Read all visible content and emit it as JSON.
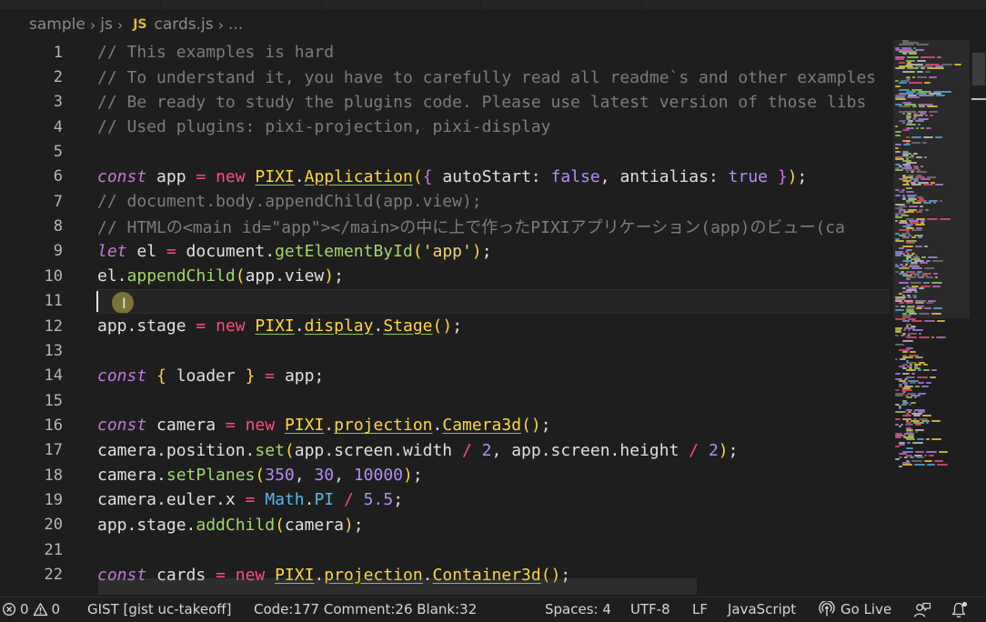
{
  "breadcrumb": {
    "folder1": "sample",
    "folder2": "js",
    "file_badge": "JS",
    "file": "cards.js",
    "more": "..."
  },
  "editor": {
    "line_numbers": [
      "1",
      "2",
      "3",
      "4",
      "5",
      "6",
      "7",
      "8",
      "9",
      "10",
      "11",
      "12",
      "13",
      "14",
      "15",
      "16",
      "17",
      "18",
      "19",
      "20",
      "21",
      "22"
    ],
    "current_line": "11"
  },
  "statusbar": {
    "errors": "0",
    "warnings": "0",
    "gist": "GIST [gist uc-takeoff]",
    "code_stats": "Code:177 Comment:26 Blank:32",
    "indentation": "Spaces: 4",
    "encoding": "UTF-8",
    "eol": "LF",
    "language": "JavaScript",
    "go_live": "Go Live"
  },
  "colors": {
    "background": "#1e1e1e",
    "comment": "#7c7c7c",
    "keyword": "#c678dd",
    "operator": "#ff4d7b",
    "class": "#ffd83a",
    "function": "#a2d86a",
    "number": "#b58cf7",
    "string": "#f0d27a"
  }
}
